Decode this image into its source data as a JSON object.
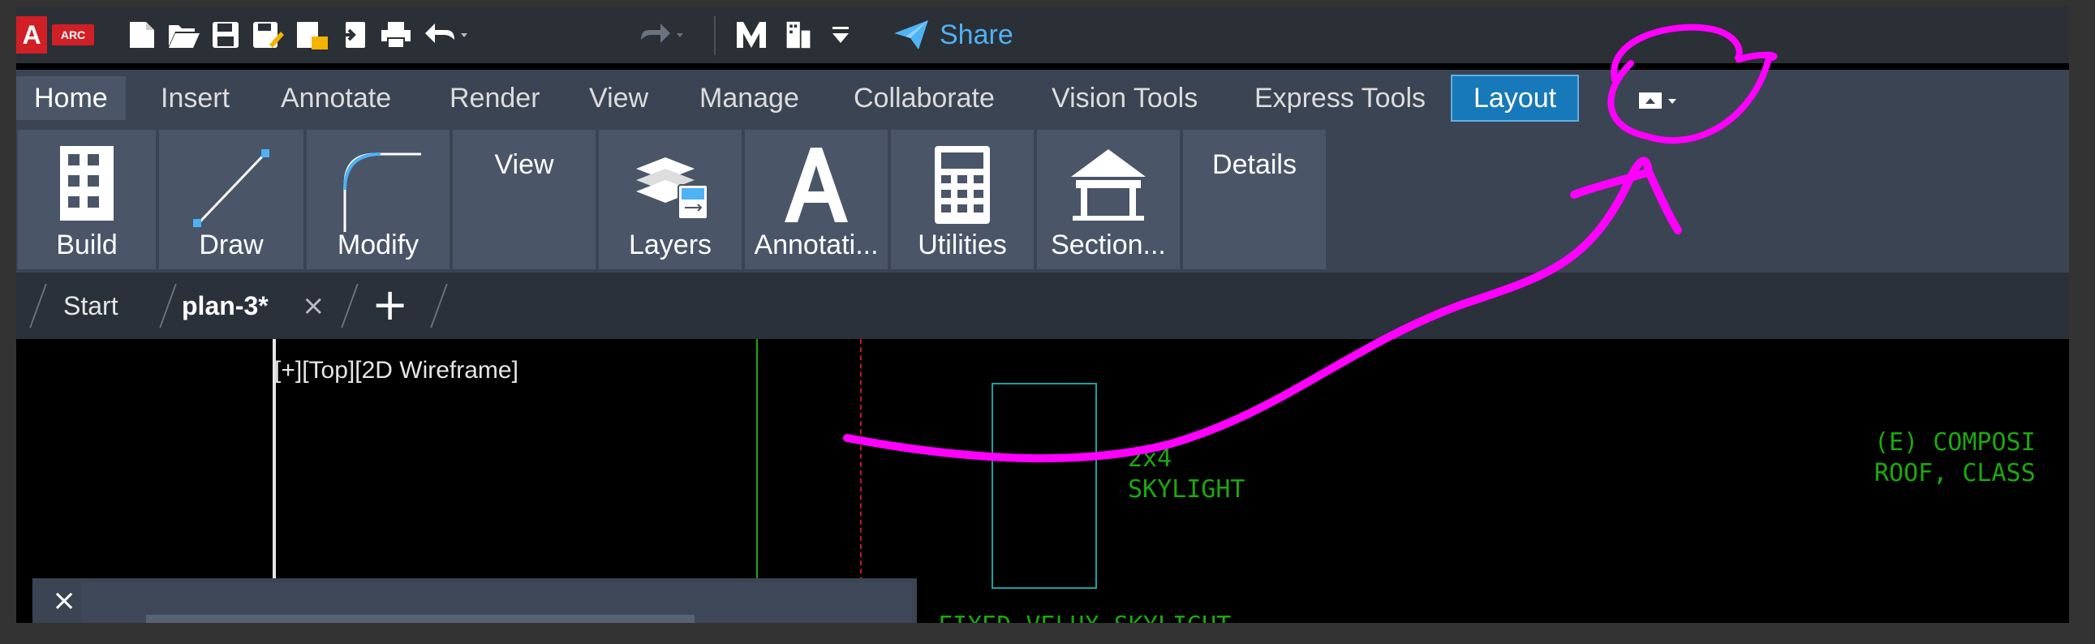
{
  "app": {
    "logo_letter": "A",
    "logo_product": "ARC"
  },
  "quick_access": {
    "icons": [
      "new-icon",
      "open-icon",
      "save-icon",
      "save-as-icon",
      "publish-icon",
      "import-icon",
      "print-icon",
      "undo-icon",
      "redo-icon",
      "brand-icon",
      "workspace-icon",
      "customize-icon"
    ],
    "share_label": "Share"
  },
  "ribbon_tabs": [
    {
      "label": "Home"
    },
    {
      "label": "Insert"
    },
    {
      "label": "Annotate"
    },
    {
      "label": "Render"
    },
    {
      "label": "View"
    },
    {
      "label": "Manage"
    },
    {
      "label": "Collaborate"
    },
    {
      "label": "Vision Tools"
    },
    {
      "label": "Express Tools"
    },
    {
      "label": "Layout"
    }
  ],
  "ribbon_panels": [
    {
      "label": "Build"
    },
    {
      "label": "Draw"
    },
    {
      "label": "Modify"
    },
    {
      "label": "View"
    },
    {
      "label": "Layers"
    },
    {
      "label": "Annotati..."
    },
    {
      "label": "Utilities"
    },
    {
      "label": "Section..."
    },
    {
      "label": "Details"
    }
  ],
  "doc_tabs": {
    "start": "Start",
    "current": "plan-3*",
    "close_symbol": "×",
    "new_symbol": "+"
  },
  "drawing": {
    "viewport_label": "[+][Top][2D Wireframe]",
    "texts": {
      "size": "2x4",
      "skylight": "SKYLIGHT",
      "roof1": "(E) COMPOSI",
      "roof2": "ROOF, CLASS",
      "fixed": "FIXED VELUX SKYLIGHT"
    }
  },
  "command": {
    "close_symbol": "×"
  },
  "colors": {
    "annotation": "#ff00ff",
    "cad_green": "#1ca80e",
    "cad_cyan": "#1aa0a0",
    "accent": "#1779b9"
  }
}
